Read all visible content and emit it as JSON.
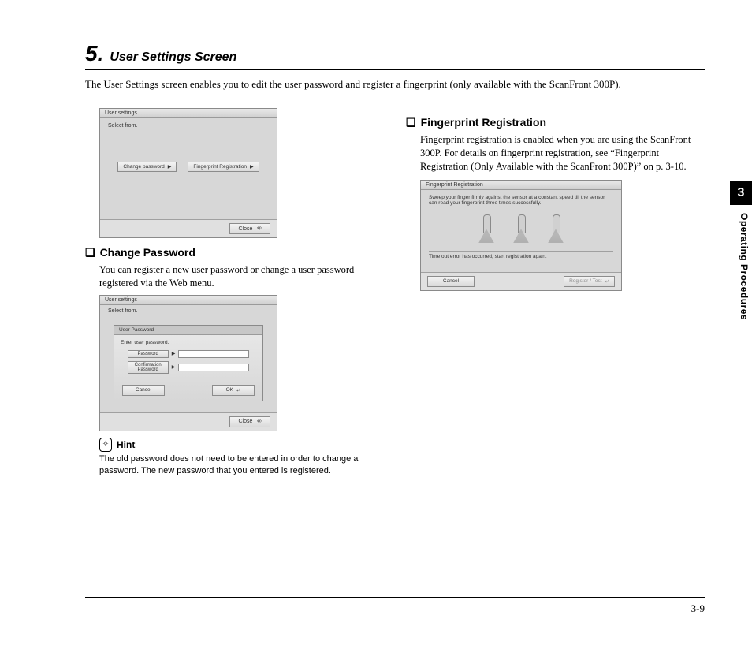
{
  "chapter": {
    "number": "5.",
    "title": "User Settings Screen"
  },
  "intro": "The User Settings screen enables you to edit the user password and register a fingerprint (only available with the ScanFront 300P).",
  "screenshot1": {
    "title": "User settings",
    "select": "Select from.",
    "btn_change": "Change password",
    "btn_fp": "Fingerprint Registration",
    "close": "Close"
  },
  "sec_change": {
    "heading": "Change Password",
    "body": "You can register a new user password or change a user password registered via the Web menu."
  },
  "screenshot2": {
    "title": "User settings",
    "select": "Select from.",
    "panel_title": "User Password",
    "prompt": "Enter user password.",
    "lbl_pw": "Password",
    "lbl_conf": "Confirmation Password",
    "cancel": "Cancel",
    "ok": "OK",
    "close": "Close"
  },
  "hint": {
    "label": "Hint",
    "text": "The old password does not need to be entered in order to change a password. The new password that you entered is registered."
  },
  "sec_fp": {
    "heading": "Fingerprint Registration",
    "body": "Fingerprint registration is enabled when you are using the ScanFront 300P. For details on fingerprint registration, see “Fingerprint Registration (Only Available with the ScanFront 300P)” on p. 3-10."
  },
  "screenshot3": {
    "title": "Fingerprint Registration",
    "instr": "Sweep your finger firmly against the sensor at a constant speed till the sensor can read your fingerprint three times successfully.",
    "error": "Time out error has occurred, start registration again.",
    "cancel": "Cancel",
    "register": "Register / Test"
  },
  "side": {
    "chapter": "3",
    "label": "Operating Procedures"
  },
  "page_number": "3-9"
}
